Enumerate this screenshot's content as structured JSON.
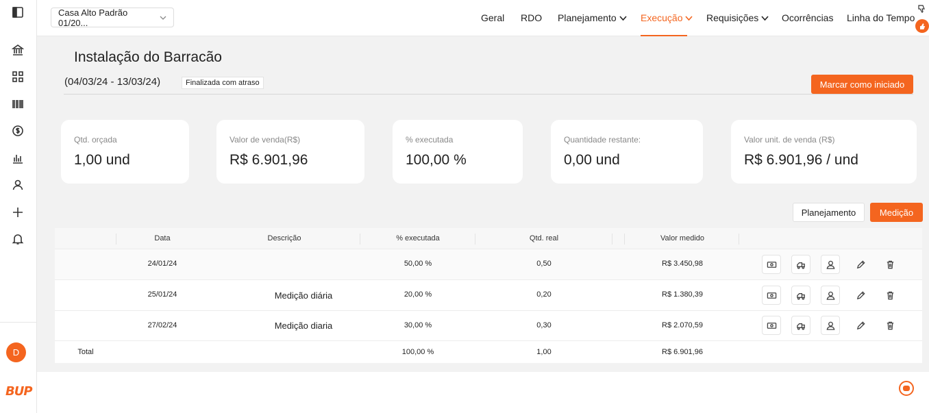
{
  "topbar": {
    "project": "Casa Alto Padrão 01/20...",
    "nav": [
      "Geral",
      "RDO",
      "Planejamento",
      "Execução",
      "Requisições",
      "Ocorrências",
      "Linha do Tempo"
    ]
  },
  "header": {
    "title": "Instalação do Barracão",
    "dates": "(04/03/24 - 13/03/24)",
    "status": "Finalizada com atraso",
    "action": "Marcar como iniciado"
  },
  "cards": [
    {
      "label": "Qtd. orçada",
      "value": "1,00 und"
    },
    {
      "label": "Valor de venda(R$)",
      "value": "R$ 6.901,96"
    },
    {
      "label": "% executada",
      "value": "100,00 %"
    },
    {
      "label": "Quantidade restante:",
      "value": "0,00 und"
    },
    {
      "label": "Valor unit. de venda (R$)",
      "value": "R$ 6.901,96 / und"
    }
  ],
  "tabs": {
    "planejamento": "Planejamento",
    "medicao": "Medição"
  },
  "table": {
    "headers": [
      "Data",
      "Descrição",
      "% executada",
      "Qtd. real",
      "Valor medido"
    ],
    "rows": [
      {
        "data": "24/01/24",
        "descricao": "",
        "pct": "50,00 %",
        "qtd": "0,50",
        "valor": "R$ 3.450,98"
      },
      {
        "data": "25/01/24",
        "descricao": "Medição diária",
        "pct": "20,00 %",
        "qtd": "0,20",
        "valor": "R$ 1.380,39"
      },
      {
        "data": "27/02/24",
        "descricao": "Medição diaria",
        "pct": "30,00 %",
        "qtd": "0,30",
        "valor": "R$ 2.070,59"
      }
    ],
    "total": {
      "label": "Total",
      "pct": "100,00 %",
      "qtd": "1,00",
      "valor": "R$ 6.901,96"
    }
  },
  "sidebar": {
    "avatar": "D",
    "logo": "BUP"
  },
  "colors": {
    "accent": "#f4651f"
  }
}
